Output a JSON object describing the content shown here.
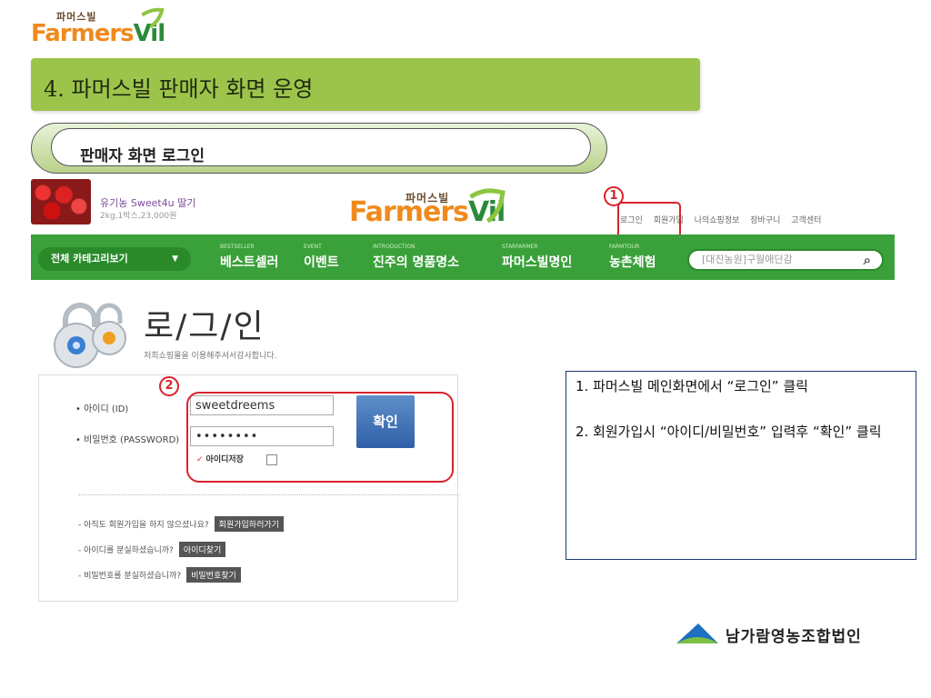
{
  "slide": {
    "logo_small": "파머스빌",
    "logo_word_a": "Farmers",
    "logo_word_b": "Vil",
    "title": "4. 파머스빌 판매자 화면 운영",
    "section": "판매자 화면 로그인"
  },
  "site": {
    "promo_title": "유기농 Sweet4u 딸기",
    "promo_price": "2kg,1박스,23,000원",
    "logo_small": "파머스빌",
    "logo_word_a": "Farmers",
    "logo_word_b": "Vil",
    "top_links": [
      "로그인",
      "회원가입",
      "나의쇼핑정보",
      "장바구니",
      "고객센터"
    ],
    "category_button": "전체 카테고리보기",
    "category_arrow": "▼",
    "nav": [
      {
        "sub": "BESTSELLER",
        "label": "베스트셀러"
      },
      {
        "sub": "EVENT",
        "label": "이벤트"
      },
      {
        "sub": "INTRODUCTION",
        "label": "진주의 명품명소"
      },
      {
        "sub": "STARFARMER",
        "label": "파머스빌명인"
      },
      {
        "sub": "FARMTOUR",
        "label": "농촌체험"
      }
    ],
    "search_placeholder": "[대진농원]구월애단감",
    "search_icon": "magnifier-icon"
  },
  "login": {
    "title": "로/그/인",
    "subtitle": "저희쇼핑몰을 이용해주셔서감사합니다.",
    "id_label": "• 아이디 (ID)",
    "pw_label": "• 비밀번호 (PASSWORD)",
    "id_value": "sweetdreems",
    "pw_value": "••••••••",
    "confirm": "확인",
    "save_id": "아이디저장",
    "help": [
      {
        "text": "- 아직도 회원가입을 하지 않으셨나요?",
        "button": "회원가입하러가기"
      },
      {
        "text": "- 아이디를 분실하셨습니까?",
        "button": "아이디찾기"
      },
      {
        "text": "- 비밀번호를 분실하셨습니까?",
        "button": "비밀번호찾기"
      }
    ]
  },
  "markers": {
    "one": "1",
    "two": "2"
  },
  "notes": {
    "step1": "1. 파머스빌 메인화면에서 “로그인” 클릭",
    "step2": "2. 회원가입시 “아이디/비밀번호” 입력후 “확인” 클릭"
  },
  "footer": {
    "org": "남가람영농조합법인"
  },
  "colors": {
    "title_bar": "#9dc44a",
    "nav_green": "#3aa03a",
    "highlight_red": "#d9232b",
    "confirm_blue": "#2f5fa8"
  }
}
